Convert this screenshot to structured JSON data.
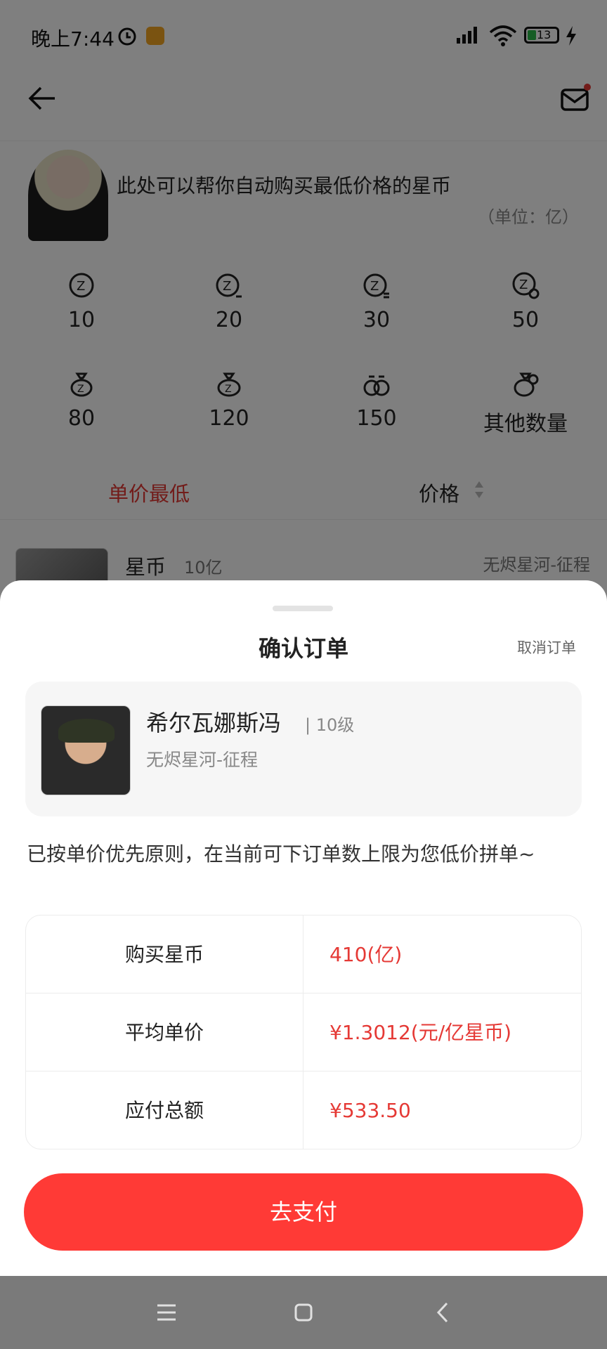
{
  "status_bar": {
    "time": "晚上7:44",
    "battery": "13"
  },
  "background": {
    "hero_text": "此处可以帮你自动购买最低价格的星币",
    "hero_unit": "（单位：亿）",
    "quick_amounts": [
      "10",
      "20",
      "30",
      "50",
      "80",
      "120",
      "150",
      "其他数量"
    ],
    "sort": {
      "lowest_label": "单价最低",
      "price_label": "价格"
    },
    "listing": {
      "title": "星币",
      "amount": "10亿",
      "server": "无烬星河-征程"
    }
  },
  "sheet": {
    "title": "确认订单",
    "cancel_label": "取消订单",
    "role": {
      "name": "希尔瓦娜斯冯",
      "level": "| 10级",
      "server": "无烬星河-征程"
    },
    "notice": "已按单价优先原则，在当前可下订单数上限为您低价拼单~",
    "summary": [
      {
        "label": "购买星币",
        "value": "410(亿)"
      },
      {
        "label": "平均单价",
        "value": "¥1.3012(元/亿星币)"
      },
      {
        "label": "应付总额",
        "value": "¥533.50"
      }
    ],
    "pay_label": "去支付"
  },
  "colors": {
    "accent": "#ff3a36",
    "price_red": "#e53935"
  }
}
